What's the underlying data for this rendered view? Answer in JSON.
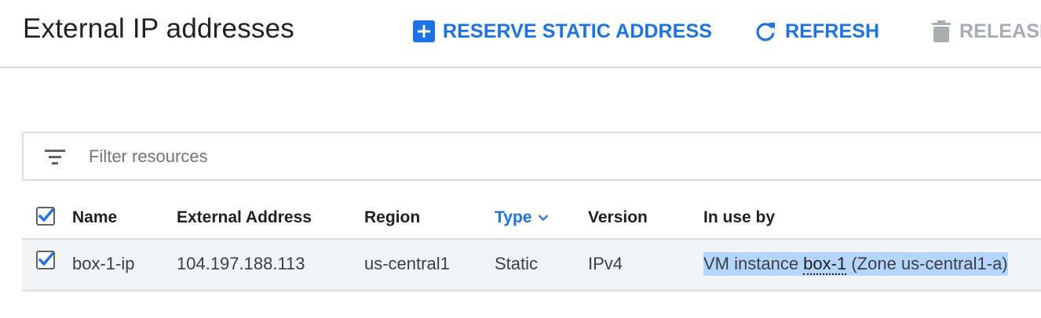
{
  "header": {
    "title": "External IP addresses",
    "actions": {
      "reserve": "RESERVE STATIC ADDRESS",
      "refresh": "REFRESH",
      "release": "RELEASE"
    }
  },
  "filter": {
    "placeholder": "Filter resources",
    "value": ""
  },
  "table": {
    "columns": {
      "name": "Name",
      "external_address": "External Address",
      "region": "Region",
      "type": "Type",
      "version": "Version",
      "in_use_by": "In use by"
    },
    "sorted_column": "Type",
    "select_all_checked": true,
    "rows": [
      {
        "checked": true,
        "name": "box-1-ip",
        "external_address": "104.197.188.113",
        "region": "us-central1",
        "type": "Static",
        "version": "IPv4",
        "in_use_by": {
          "prefix": "VM instance ",
          "link": "box-1",
          "suffix": " (Zone us-central1-a)"
        }
      }
    ]
  },
  "colors": {
    "accent": "#1a73e8",
    "disabled": "#a9acb0",
    "selection": "#b4d5fd",
    "row_bg": "#f1f3f4",
    "border": "#dadce0"
  },
  "icons": {
    "reserve": "add-box-icon",
    "refresh": "refresh-icon",
    "release": "trash-icon",
    "filter": "filter-list-icon",
    "sort": "chevron-down-icon",
    "checkbox": "checkbox-checked-icon"
  }
}
